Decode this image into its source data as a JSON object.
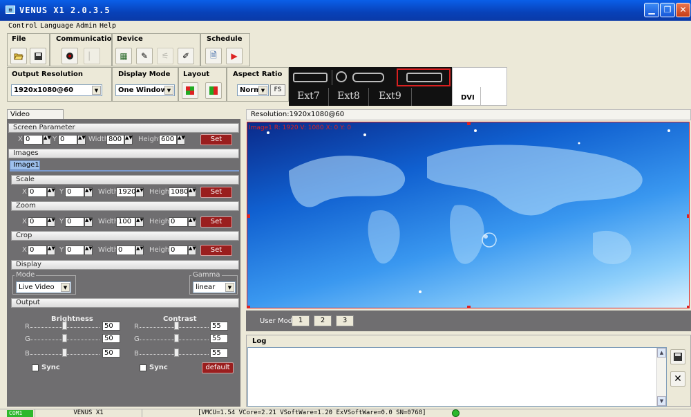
{
  "window": {
    "title": "VENUS X1 2.0.3.5"
  },
  "menu": [
    "Control",
    "Language",
    "Admin",
    "Help"
  ],
  "toolbar": {
    "file": "File",
    "communication": "Communication",
    "device": "Device",
    "schedule": "Schedule"
  },
  "settings": {
    "output_resolution_label": "Output Resolution",
    "output_resolution_value": "1920x1080@60",
    "display_mode_label": "Display Mode",
    "display_mode_value": "One Window",
    "layout_label": "Layout",
    "aspect_ratio_label": "Aspect Ratio",
    "aspect_ratio_value": "Normal",
    "fs_label": "FS"
  },
  "inputs": {
    "ext7": "Ext7",
    "ext8": "Ext8",
    "ext9": "Ext9",
    "dvi": "DVI"
  },
  "video_processor": {
    "tab": "Video Processor",
    "screen_parameter": "Screen Parameter",
    "screen": {
      "x": "0",
      "y": "0",
      "width": "800",
      "height": "600"
    },
    "images": "Images",
    "image_tab": "Image1",
    "scale": {
      "label": "Scale",
      "x": "0",
      "y": "0",
      "width": "1920",
      "height": "1080"
    },
    "zoom": {
      "label": "Zoom",
      "x": "0",
      "y": "0",
      "width": "100",
      "height": "0"
    },
    "crop": {
      "label": "Crop",
      "x": "0",
      "y": "0",
      "width": "0",
      "height": "0"
    },
    "labels": {
      "x": "X",
      "y": "Y",
      "width": "Width",
      "height": "Height",
      "set": "Set"
    },
    "display": "Display",
    "mode_label": "Mode",
    "mode_value": "Live Video",
    "gamma_label": "Gamma",
    "gamma_value": "linear",
    "output": "Output",
    "brightness": {
      "label": "Brightness",
      "r": "50",
      "g": "50",
      "b": "50"
    },
    "contrast": {
      "label": "Contrast",
      "r": "55",
      "g": "55",
      "b": "55"
    },
    "rgb": {
      "r": "R",
      "g": "G",
      "b": "B"
    },
    "sync": "Sync",
    "default": "default"
  },
  "preview": {
    "resolution_text": "Resolution:1920x1080@60",
    "overlay": "Image1 R: 1920 V: 1080 X: 0 Y: 0",
    "user_mode_label": "User Mode",
    "user_modes": [
      "1",
      "2",
      "3"
    ]
  },
  "log": {
    "title": "Log"
  },
  "statusbar": {
    "com": "COM1",
    "device": "VENUS X1",
    "versions": "[VMCU=1.54 VCore=2.21 VSoftWare=1.20 ExVSoftWare=0.0 SN=0768]"
  },
  "colors": {
    "title_blue": "#0841b8",
    "set_red": "#9a1e1e",
    "panel_gray": "#6f6e70",
    "dvi_red": "#d82020",
    "status_green": "#2db82d"
  }
}
